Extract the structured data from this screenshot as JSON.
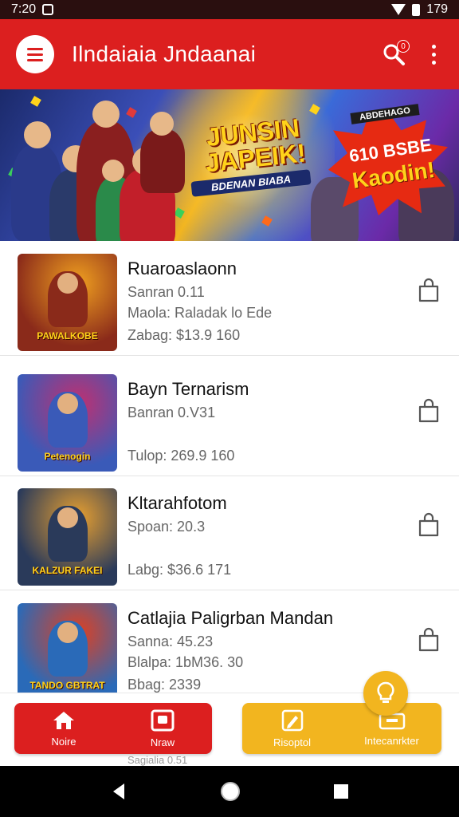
{
  "status_bar": {
    "time": "7:20",
    "battery": "179"
  },
  "app_bar": {
    "title": "Ilndaiaia Jndaanai",
    "search_badge": "0"
  },
  "banner": {
    "headline": "JUNSIN JAPEIK!",
    "tagline": "BDENAN BIABA",
    "burst_top": "ABDEHAGO",
    "burst_line1": "610 BSBE",
    "burst_line2": "Kaodin!"
  },
  "items": [
    {
      "title": "Ruaroaslaonn",
      "line1": "Sanran 0.11",
      "line2": "Maola: Raladak lo Ede",
      "line3": "Zabag: $13.9    160",
      "thumb_caption": "PAWALKOBE",
      "thumb_bg": "#8a2a1a",
      "thumb_accent": "#f0a020"
    },
    {
      "title": "Bayn Ternarism",
      "line1": "Banran 0.V31",
      "line2": "",
      "line3": "Tulop: 269.9    160",
      "thumb_caption": "Petenogin",
      "thumb_bg": "#3a5ab8",
      "thumb_accent": "#c03070"
    },
    {
      "title": "Kltarahfotom",
      "line1": "Spoan: 20.3",
      "line2": "",
      "line3": "Labg: $36.6    171",
      "thumb_caption": "KALZUR FAKEI",
      "thumb_bg": "#2a3a5a",
      "thumb_accent": "#e8a030"
    },
    {
      "title": "Catlajia Paligrban Mandan",
      "line1": "Sanna: 45.23",
      "line2": "Blalpa: 1bM36.  30",
      "line3": "Bbag: 2339",
      "thumb_caption": "TANDO GBTRAT",
      "thumb_bg": "#2a6ab8",
      "thumb_accent": "#e04020"
    }
  ],
  "peek": {
    "text": "Sagialia 0.51"
  },
  "bottom_nav": {
    "home_label": "Noire",
    "new_label": "Nraw",
    "report_label": "Risoptol",
    "info_label": "Intecanrkter"
  },
  "colors": {
    "primary": "#dc1f1f",
    "accent": "#f2b51f"
  }
}
